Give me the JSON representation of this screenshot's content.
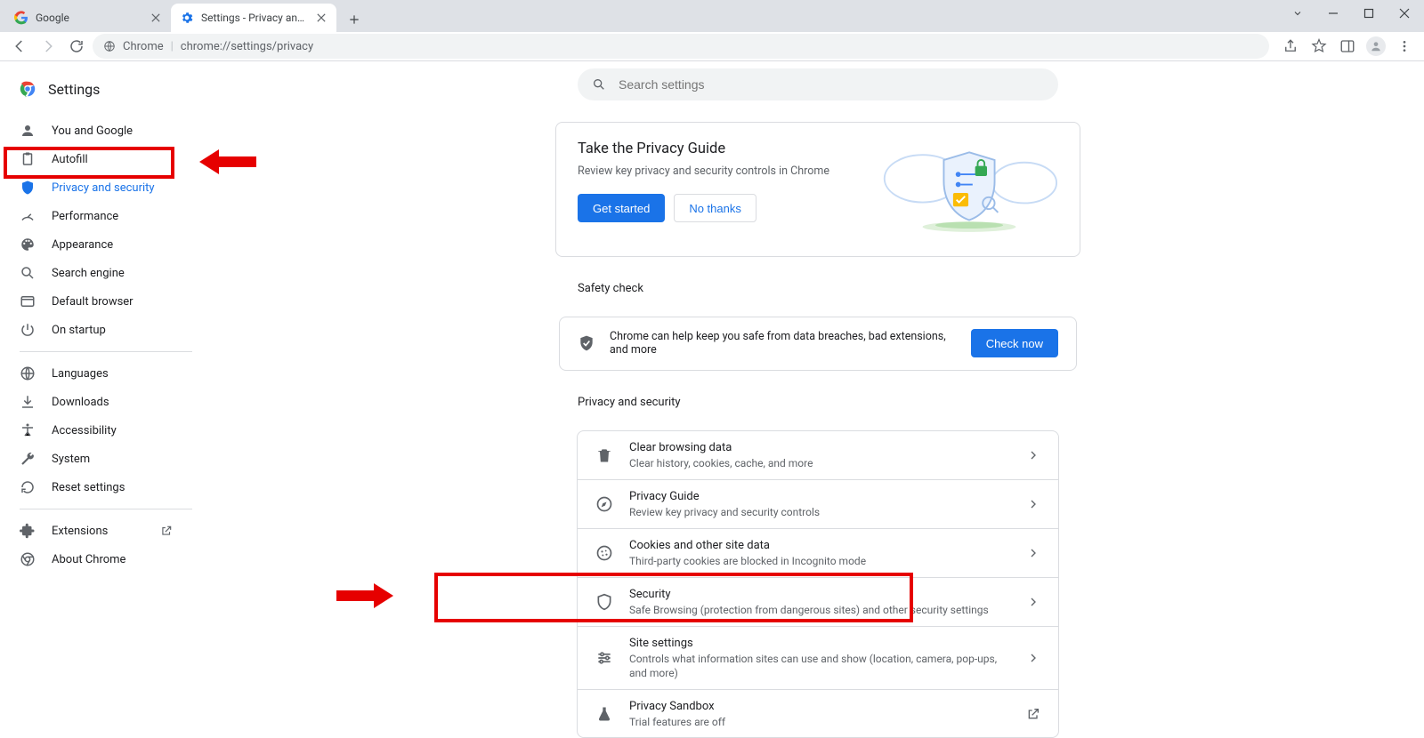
{
  "window": {
    "tabs": [
      {
        "title": "Google",
        "active": false
      },
      {
        "title": "Settings - Privacy and security",
        "active": true
      }
    ]
  },
  "omnibox": {
    "scheme": "Chrome",
    "url": "chrome://settings/privacy"
  },
  "brand": {
    "title": "Settings"
  },
  "search": {
    "placeholder": "Search settings"
  },
  "sidebar": {
    "groups": [
      [
        {
          "id": "you",
          "label": "You and Google"
        },
        {
          "id": "autofill",
          "label": "Autofill"
        },
        {
          "id": "privacy",
          "label": "Privacy and security",
          "active": true
        },
        {
          "id": "performance",
          "label": "Performance"
        },
        {
          "id": "appearance",
          "label": "Appearance"
        },
        {
          "id": "search",
          "label": "Search engine"
        },
        {
          "id": "default",
          "label": "Default browser"
        },
        {
          "id": "startup",
          "label": "On startup"
        }
      ],
      [
        {
          "id": "languages",
          "label": "Languages"
        },
        {
          "id": "downloads",
          "label": "Downloads"
        },
        {
          "id": "accessibility",
          "label": "Accessibility"
        },
        {
          "id": "system",
          "label": "System"
        },
        {
          "id": "reset",
          "label": "Reset settings"
        }
      ],
      [
        {
          "id": "extensions",
          "label": "Extensions",
          "external": true
        },
        {
          "id": "about",
          "label": "About Chrome"
        }
      ]
    ]
  },
  "privacyGuide": {
    "title": "Take the Privacy Guide",
    "desc": "Review key privacy and security controls in Chrome",
    "primary": "Get started",
    "secondary": "No thanks"
  },
  "sections": {
    "safety": {
      "label": "Safety check",
      "text": "Chrome can help keep you safe from data breaches, bad extensions, and more",
      "action": "Check now"
    },
    "privacy": {
      "label": "Privacy and security",
      "rows": [
        {
          "id": "clear",
          "title": "Clear browsing data",
          "sub": "Clear history, cookies, cache, and more"
        },
        {
          "id": "guide",
          "title": "Privacy Guide",
          "sub": "Review key privacy and security controls"
        },
        {
          "id": "cookies",
          "title": "Cookies and other site data",
          "sub": "Third-party cookies are blocked in Incognito mode"
        },
        {
          "id": "security",
          "title": "Security",
          "sub": "Safe Browsing (protection from dangerous sites) and other security settings"
        },
        {
          "id": "site",
          "title": "Site settings",
          "sub": "Controls what information sites can use and show (location, camera, pop-ups, and more)"
        },
        {
          "id": "sandbox",
          "title": "Privacy Sandbox",
          "sub": "Trial features are off",
          "external": true
        }
      ]
    }
  }
}
